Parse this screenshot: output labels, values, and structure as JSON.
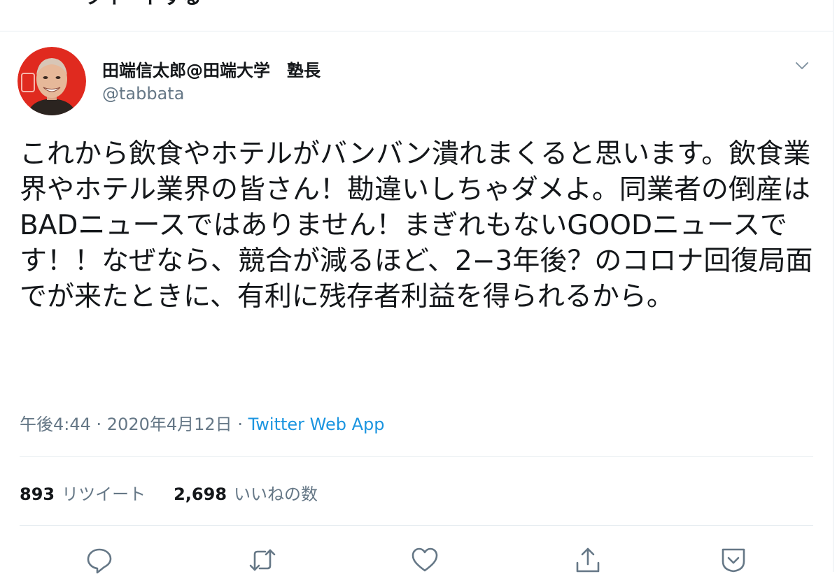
{
  "header": {
    "title": "ツイートする"
  },
  "tweet": {
    "author": {
      "display_name": "田端信太郎@田端大学　塾長",
      "handle": "@tabbata"
    },
    "text": "これから飲食やホテルがバンバン潰れまくると思います。飲食業界やホテル業界の皆さん！勘違いしちゃダメよ。同業者の倒産はBADニュースではありません！まぎれもないGOODニュースです！！なぜなら、競合が減るほど、2−3年後？のコロナ回復局面でが来たときに、有利に残存者利益を得られるから。",
    "time": "午後4:44",
    "date": "2020年4月12日",
    "separator": " · ",
    "source": "Twitter Web App",
    "retweets_count": "893",
    "retweets_label": "リツイート",
    "likes_count": "2,698",
    "likes_label": "いいねの数"
  },
  "icons": {
    "back": "back-arrow-icon",
    "caret": "chevron-down-icon",
    "reply": "reply-icon",
    "retweet": "retweet-icon",
    "like": "heart-icon",
    "share": "share-icon",
    "save": "save-icon"
  },
  "colors": {
    "text": "#14171a",
    "secondary": "#657786",
    "link": "#1b95e0",
    "border": "#e6ecf0",
    "avatar_bg": "#e02a1f"
  }
}
